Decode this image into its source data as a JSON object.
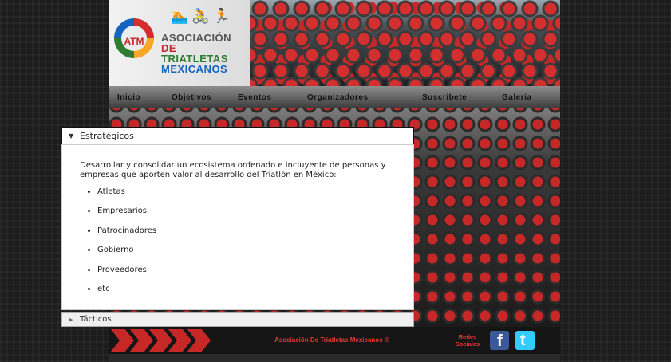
{
  "logo": {
    "abbr": "ATM",
    "line1": "ASOCIACIÓN",
    "line1_de": "DE",
    "line2": "TRIATLETAS",
    "line3": "MEXICANOS",
    "sport_icons": "🏊🚴🏃"
  },
  "nav": {
    "items": [
      "Inicio",
      "Objetivos",
      "Eventos",
      "Organizadores",
      "Suscribete",
      "Galeria"
    ]
  },
  "accordion": {
    "section1_title": "Estratégicos",
    "section1_text": "Desarrollar y consolidar un ecosistema ordenado e incluyente de personas y empresas que aporten valor al desarrollo del Triatlón en México:",
    "section1_items": [
      "Atletas",
      "Empresarios",
      "Patrocinadores",
      "Gobierno",
      "Proveedores",
      "etc"
    ],
    "section2_title": "Tácticos"
  },
  "footer": {
    "copyright": "Asociación De Triatletas Mexicanos ©",
    "redes_line1": "Redes",
    "redes_line2": "Sociales",
    "facebook_glyph": "f",
    "twitter_glyph": "t"
  },
  "colors": {
    "accent_red": "#c62828",
    "facebook": "#3b5998",
    "twitter": "#33ccff"
  }
}
